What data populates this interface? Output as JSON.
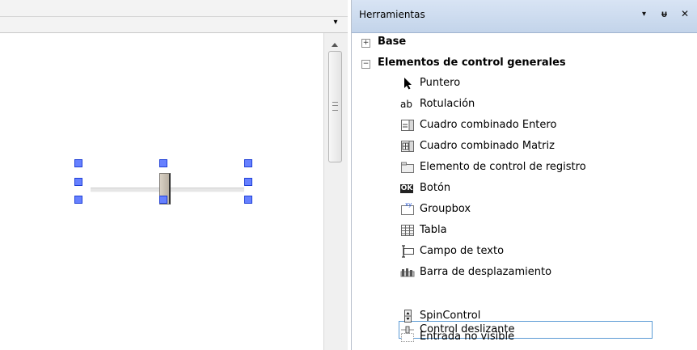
{
  "editor": {
    "dropdown_glyph": "▾"
  },
  "toolbox": {
    "title": "Herramientas",
    "header_dropdown": "▾",
    "header_pin": "ᵾ",
    "header_close": "✕",
    "groups": [
      {
        "expander": "+",
        "label": "Base"
      },
      {
        "expander": "−",
        "label": "Elementos de control generales"
      }
    ],
    "items": [
      {
        "label": "Puntero",
        "icon": "pointer-icon"
      },
      {
        "label": "Rotulación",
        "icon": "label-icon",
        "icon_text": "ab"
      },
      {
        "label": "Cuadro combinado Entero",
        "icon": "combobox-integer-icon"
      },
      {
        "label": "Cuadro combinado Matriz",
        "icon": "combobox-array-icon"
      },
      {
        "label": "Elemento de control de registro",
        "icon": "tab-control-icon"
      },
      {
        "label": "Botón",
        "icon": "button-icon",
        "icon_text": "OK"
      },
      {
        "label": "Groupbox",
        "icon": "groupbox-icon",
        "icon_text": "xy"
      },
      {
        "label": "Tabla",
        "icon": "table-icon"
      },
      {
        "label": "Campo de texto",
        "icon": "text-field-icon"
      },
      {
        "label": "Barra de desplazamiento",
        "icon": "scrollbar-icon"
      },
      {
        "label": "Control deslizante",
        "icon": "slider-icon",
        "selected": true
      },
      {
        "label": "SpinControl",
        "icon": "spin-control-icon"
      },
      {
        "label": "Entrada no visible",
        "icon": "invisible-input-icon"
      }
    ]
  }
}
